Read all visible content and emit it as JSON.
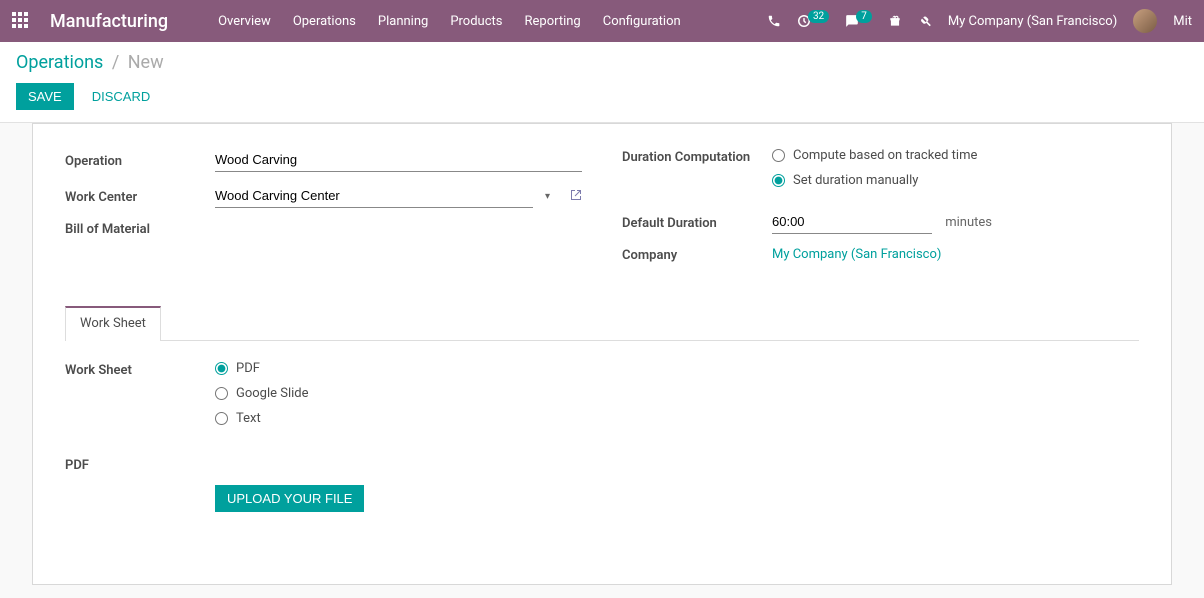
{
  "navbar": {
    "brand": "Manufacturing",
    "menu": [
      "Overview",
      "Operations",
      "Planning",
      "Products",
      "Reporting",
      "Configuration"
    ],
    "activity_count": "32",
    "message_count": "7",
    "company": "My Company (San Francisco)",
    "username": "Mit"
  },
  "breadcrumb": {
    "parent": "Operations",
    "current": "New"
  },
  "actions": {
    "save": "SAVE",
    "discard": "DISCARD"
  },
  "form": {
    "left": {
      "operation_label": "Operation",
      "operation_value": "Wood Carving",
      "workcenter_label": "Work Center",
      "workcenter_value": "Wood Carving Center",
      "bom_label": "Bill of Material",
      "bom_value": ""
    },
    "right": {
      "duration_comp_label": "Duration Computation",
      "opt_tracked": "Compute based on tracked time",
      "opt_manual": "Set duration manually",
      "default_duration_label": "Default Duration",
      "default_duration_value": "60:00",
      "default_duration_unit": "minutes",
      "company_label": "Company",
      "company_value": "My Company (San Francisco)"
    }
  },
  "tabs": {
    "worksheet_tab": "Work Sheet"
  },
  "worksheet": {
    "label": "Work Sheet",
    "opt_pdf": "PDF",
    "opt_slide": "Google Slide",
    "opt_text": "Text",
    "pdf_label": "PDF",
    "upload": "UPLOAD YOUR FILE"
  }
}
